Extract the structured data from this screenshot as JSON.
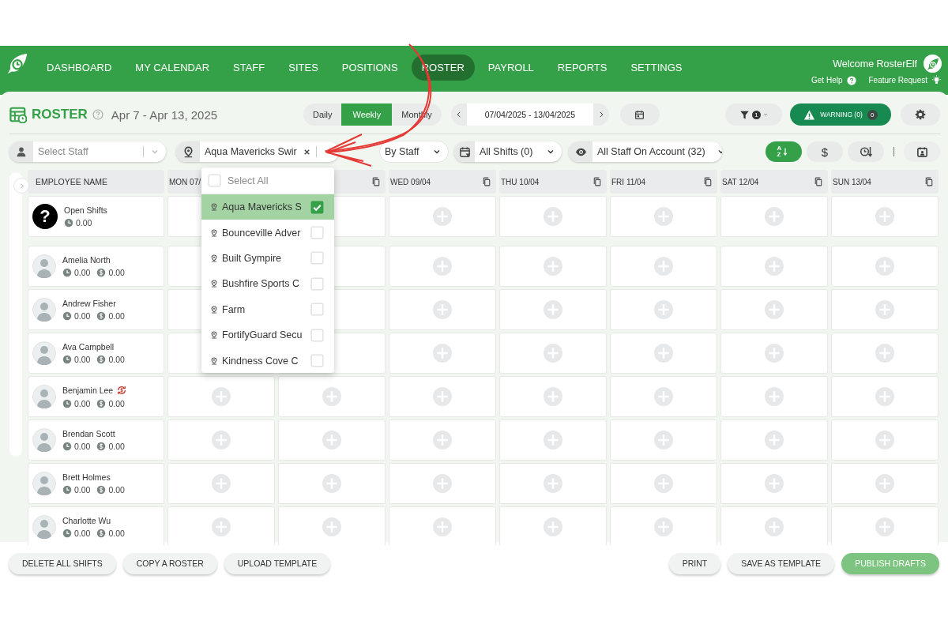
{
  "nav": {
    "items": [
      {
        "label": "DASHBOARD",
        "selected": false
      },
      {
        "label": "MY CALENDAR",
        "selected": false
      },
      {
        "label": "STAFF",
        "selected": false
      },
      {
        "label": "SITES",
        "selected": false
      },
      {
        "label": "POSITIONS",
        "selected": false
      },
      {
        "label": "ROSTER",
        "selected": true
      },
      {
        "label": "PAYROLL",
        "selected": false
      },
      {
        "label": "REPORTS",
        "selected": false
      },
      {
        "label": "SETTINGS",
        "selected": false
      }
    ],
    "welcome": "Welcome RosterElf",
    "help": "Get Help",
    "feature": "Feature Request"
  },
  "header": {
    "title": "ROSTER",
    "date_range": "Apr 7 - Apr 13, 2025",
    "views": [
      {
        "label": "Daily",
        "selected": false
      },
      {
        "label": "Weekly",
        "selected": true
      },
      {
        "label": "Monthly",
        "selected": false
      }
    ],
    "date_field": "07/04/2025 - 13/04/2025",
    "filter_count": "1",
    "warning": {
      "label": "WARNING (0)",
      "count": "0"
    }
  },
  "filters": {
    "staff": {
      "placeholder": "Select Staff"
    },
    "site": {
      "value": "Aqua Mavericks Swir"
    },
    "group": "By Staff",
    "shifts": "All Shifts (0)",
    "visibility": "All Staff On Account (32)",
    "sort": [
      {
        "kind": "alpha",
        "label": "AZ",
        "selected": true
      },
      {
        "kind": "cost",
        "label": "$",
        "selected": false
      },
      {
        "kind": "time",
        "selected": false
      }
    ]
  },
  "site_dropdown": {
    "open": true,
    "select_all": {
      "label": "Select All",
      "checked": false
    },
    "options": [
      {
        "label": "Aqua Mavericks S",
        "checked": true,
        "selected": true
      },
      {
        "label": "Bounceville Adver",
        "checked": false,
        "selected": false
      },
      {
        "label": "Built Gympire",
        "checked": false,
        "selected": false
      },
      {
        "label": "Bushfire Sports C",
        "checked": false,
        "selected": false
      },
      {
        "label": "Farm",
        "checked": false,
        "selected": false
      },
      {
        "label": "FortifyGuard Secu",
        "checked": false,
        "selected": false
      },
      {
        "label": "Kindness Cove C",
        "checked": false,
        "selected": false
      }
    ]
  },
  "table": {
    "name_column": "EMPLOYEE NAME",
    "days": [
      {
        "label": "MON 07/"
      },
      {
        "copy_button": true
      },
      {
        "label": "WED 09/04",
        "copy_button": true
      },
      {
        "label": "THU 10/04",
        "copy_button": true
      },
      {
        "label": "FRI 11/04",
        "copy_button": true
      },
      {
        "label": "SAT 12/04",
        "copy_button": true
      },
      {
        "label": "SUN 13/04",
        "copy_button": true
      }
    ],
    "rows": [
      {
        "kind": "open",
        "name": "Open Shifts",
        "badge": "?",
        "hours": "0.00"
      },
      {
        "kind": "staff",
        "name": "Amelia North",
        "hours": "0.00",
        "cost": "0.00",
        "pay_alert": false
      },
      {
        "kind": "staff",
        "name": "Andrew Fisher",
        "hours": "0.00",
        "cost": "0.00",
        "pay_alert": false
      },
      {
        "kind": "staff",
        "name": "Ava Campbell",
        "hours": "0.00",
        "cost": "0.00",
        "pay_alert": false
      },
      {
        "kind": "staff",
        "name": "Benjamin Lee",
        "hours": "0.00",
        "cost": "0.00",
        "pay_alert": true
      },
      {
        "kind": "staff",
        "name": "Brendan Scott",
        "hours": "0.00",
        "cost": "0.00",
        "pay_alert": false
      },
      {
        "kind": "staff",
        "name": "Brett Holmes",
        "hours": "0.00",
        "cost": "0.00",
        "pay_alert": false
      },
      {
        "kind": "staff",
        "name": "Charlotte Wu",
        "hours": "0.00",
        "cost": "0.00",
        "pay_alert": false
      }
    ]
  },
  "footer": {
    "left": [
      {
        "label": "DELETE ALL SHIFTS",
        "kind": "plain"
      },
      {
        "label": "COPY A ROSTER",
        "kind": "plain"
      },
      {
        "label": "UPLOAD TEMPLATE",
        "kind": "plain"
      }
    ],
    "right": [
      {
        "label": "PRINT",
        "kind": "plain"
      },
      {
        "label": "SAVE AS TEMPLATE",
        "kind": "plain"
      },
      {
        "label": "PUBLISH DRAFTS",
        "kind": "primary"
      }
    ]
  }
}
